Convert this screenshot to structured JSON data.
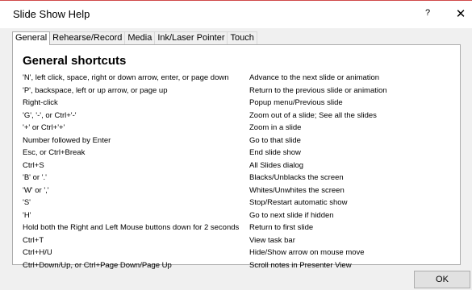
{
  "window": {
    "title": "Slide Show Help",
    "help_glyph": "?",
    "close_glyph": "✕"
  },
  "tabs": [
    {
      "label": "General",
      "active": true
    },
    {
      "label": "Rehearse/Record",
      "active": false
    },
    {
      "label": "Media",
      "active": false
    },
    {
      "label": "Ink/Laser Pointer",
      "active": false
    },
    {
      "label": "Touch",
      "active": false
    }
  ],
  "panel": {
    "heading": "General shortcuts",
    "shortcuts": [
      {
        "key": "'N', left click, space, right or down arrow, enter, or page down",
        "description": "Advance to the next slide or animation"
      },
      {
        "key": "'P', backspace, left or up arrow, or page up",
        "description": "Return to the previous slide or animation"
      },
      {
        "key": "Right-click",
        "description": "Popup menu/Previous slide"
      },
      {
        "key": "'G', '-', or Ctrl+'-'",
        "description": "Zoom out of a slide; See all the slides"
      },
      {
        "key": "'+' or Ctrl+'+'",
        "description": "Zoom in a slide"
      },
      {
        "key": "Number followed by Enter",
        "description": "Go to that slide"
      },
      {
        "key": "Esc, or Ctrl+Break",
        "description": "End slide show"
      },
      {
        "key": "Ctrl+S",
        "description": "All Slides dialog"
      },
      {
        "key": "'B' or '.'",
        "description": "Blacks/Unblacks the screen"
      },
      {
        "key": "'W' or ','",
        "description": "Whites/Unwhites the screen"
      },
      {
        "key": "'S'",
        "description": "Stop/Restart automatic show"
      },
      {
        "key": "'H'",
        "description": "Go to next slide if hidden"
      },
      {
        "key": "Hold both the Right and Left Mouse buttons down for 2 seconds",
        "description": "Return to first slide"
      },
      {
        "key": "Ctrl+T",
        "description": "View task bar"
      },
      {
        "key": "Ctrl+H/U",
        "description": "Hide/Show arrow on mouse move"
      },
      {
        "key": "Ctrl+Down/Up, or Ctrl+Page Down/Page Up",
        "description": "Scroll notes in Presenter View"
      }
    ]
  },
  "footer": {
    "ok_label": "OK"
  }
}
